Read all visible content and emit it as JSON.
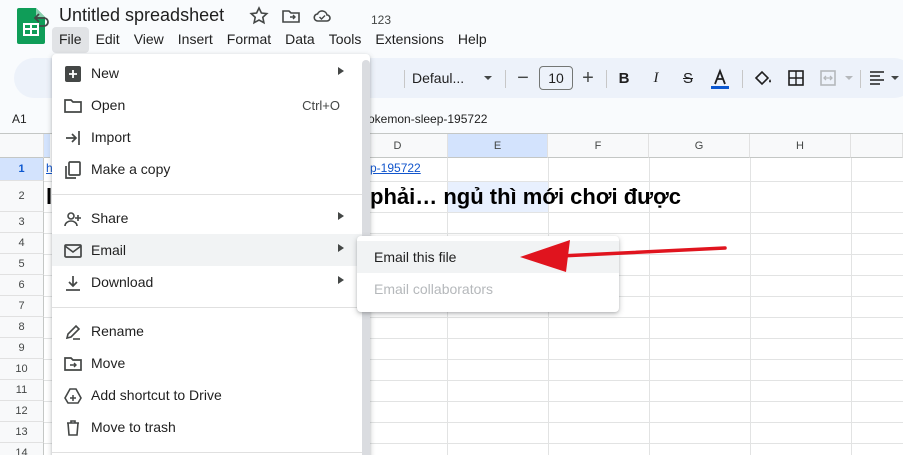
{
  "doc": {
    "title": "Untitled spreadsheet"
  },
  "menubar": [
    "File",
    "Edit",
    "View",
    "Insert",
    "Format",
    "Data",
    "Tools",
    "Extensions",
    "Help"
  ],
  "toolbar": {
    "number_format": "123",
    "font": "Defaul...",
    "font_size": "10"
  },
  "formula_bar": {
    "cell_ref": "A1",
    "content": "okemon-sleep-195722"
  },
  "columns": [
    "D",
    "E",
    "F",
    "G",
    "H"
  ],
  "rows": [
    "1",
    "2",
    "3",
    "4",
    "5",
    "6",
    "7",
    "8",
    "9",
    "10",
    "11",
    "12",
    "13",
    "14"
  ],
  "cells": {
    "a1_partial": "h",
    "d1_link": "p-195722",
    "a2_partial": "l",
    "d2_text": "phải… ngủ thì mới chơi được"
  },
  "file_menu": {
    "items": [
      {
        "label": "New",
        "icon": "new-sheet-icon"
      },
      {
        "label": "Open",
        "icon": "folder-open-icon",
        "shortcut": "Ctrl+O"
      },
      {
        "label": "Import",
        "icon": "import-icon"
      },
      {
        "label": "Make a copy",
        "icon": "copy-icon"
      },
      {
        "label": "Share",
        "icon": "share-icon"
      },
      {
        "label": "Email",
        "icon": "email-icon"
      },
      {
        "label": "Download",
        "icon": "download-icon"
      },
      {
        "label": "Rename",
        "icon": "rename-icon"
      },
      {
        "label": "Move",
        "icon": "move-folder-icon"
      },
      {
        "label": "Add shortcut to Drive",
        "icon": "drive-shortcut-icon"
      },
      {
        "label": "Move to trash",
        "icon": "trash-icon"
      }
    ]
  },
  "email_submenu": {
    "items": [
      {
        "label": "Email this file",
        "enabled": true
      },
      {
        "label": "Email collaborators",
        "enabled": false
      }
    ]
  },
  "colors": {
    "accent_blue": "#0b57d0",
    "link": "#1155cc",
    "annotation_red": "#e0141e",
    "sheets_green": "#0f9d58"
  }
}
